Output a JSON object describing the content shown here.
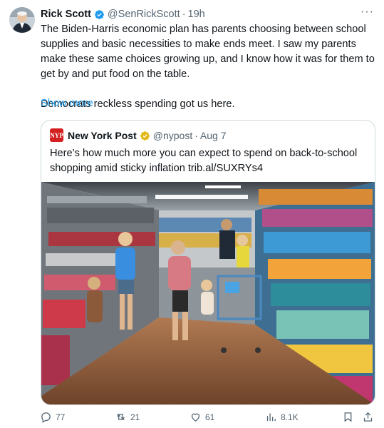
{
  "tweet": {
    "author_name": "Rick Scott",
    "handle": "@SenRickScott",
    "separator": "·",
    "time": "19h",
    "more_label": "···",
    "text": "The Biden-Harris economic plan has parents choosing between school supplies and basic necessities to make ends meet. I saw my parents make these same choices growing up, and I know how it was for them to get by and put food on the table.\n\nDemocrats reckless spending got us here.",
    "show_more": "Show more"
  },
  "quote": {
    "logo_text": "NYP",
    "author_name": "New York Post",
    "handle": "@nypost",
    "separator": "·",
    "time": "Aug 7",
    "text": "Here’s how much more you can expect to spend on back-to-school shopping amid sticky inflation trib.al/SUXRYs4"
  },
  "actions": {
    "replies": "77",
    "reposts": "21",
    "likes": "61",
    "views": "8.1K"
  },
  "colors": {
    "verified_blue": "#1d9bf0",
    "verified_gold": "#e2b719",
    "muted": "#536471",
    "link": "#1d9bf0"
  }
}
